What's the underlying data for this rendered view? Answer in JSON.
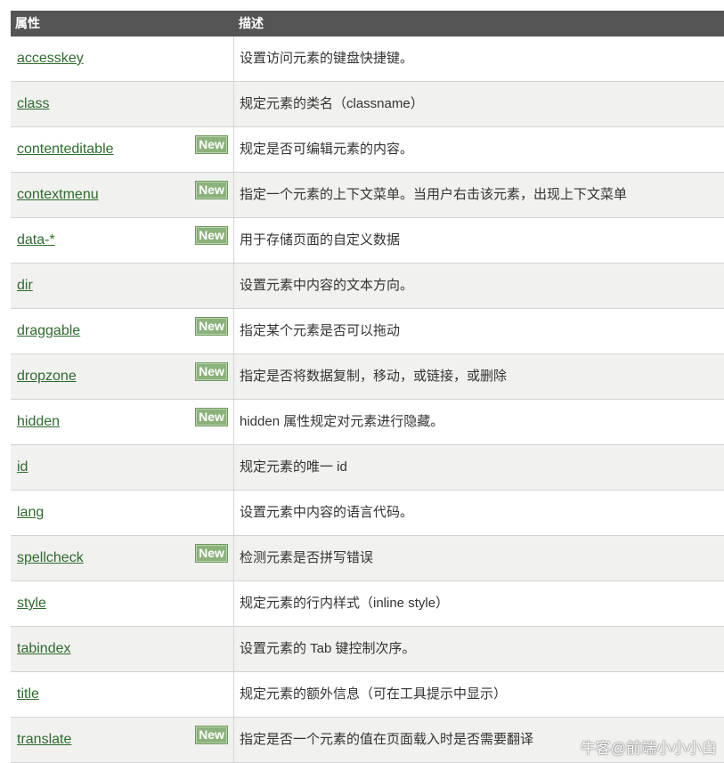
{
  "header": {
    "col1": "属性",
    "col2": "描述"
  },
  "badge_label": "New",
  "rows": [
    {
      "name": "accesskey",
      "desc": "设置访问元素的键盘快捷键。",
      "new": false
    },
    {
      "name": "class",
      "desc": "规定元素的类名（classname）",
      "new": false
    },
    {
      "name": "contenteditable",
      "desc": "规定是否可编辑元素的内容。",
      "new": true
    },
    {
      "name": "contextmenu",
      "desc": "指定一个元素的上下文菜单。当用户右击该元素，出现上下文菜单",
      "new": true
    },
    {
      "name": "data-*",
      "desc": "用于存储页面的自定义数据",
      "new": true
    },
    {
      "name": "dir",
      "desc": "设置元素中内容的文本方向。",
      "new": false
    },
    {
      "name": "draggable",
      "desc": "指定某个元素是否可以拖动",
      "new": true
    },
    {
      "name": "dropzone",
      "desc": "指定是否将数据复制，移动，或链接，或删除",
      "new": true
    },
    {
      "name": "hidden",
      "desc": "hidden 属性规定对元素进行隐藏。",
      "new": true
    },
    {
      "name": "id",
      "desc": "规定元素的唯一 id",
      "new": false
    },
    {
      "name": "lang",
      "desc": "设置元素中内容的语言代码。",
      "new": false
    },
    {
      "name": "spellcheck",
      "desc": "检测元素是否拼写错误",
      "new": true
    },
    {
      "name": "style",
      "desc": "规定元素的行内样式（inline style）",
      "new": false
    },
    {
      "name": "tabindex",
      "desc": "设置元素的 Tab 键控制次序。",
      "new": false
    },
    {
      "name": "title",
      "desc": "规定元素的额外信息（可在工具提示中显示）",
      "new": false
    },
    {
      "name": "translate",
      "desc": "指定是否一个元素的值在页面载入时是否需要翻译",
      "new": true
    }
  ],
  "watermark": "牛客@前端小小小白"
}
